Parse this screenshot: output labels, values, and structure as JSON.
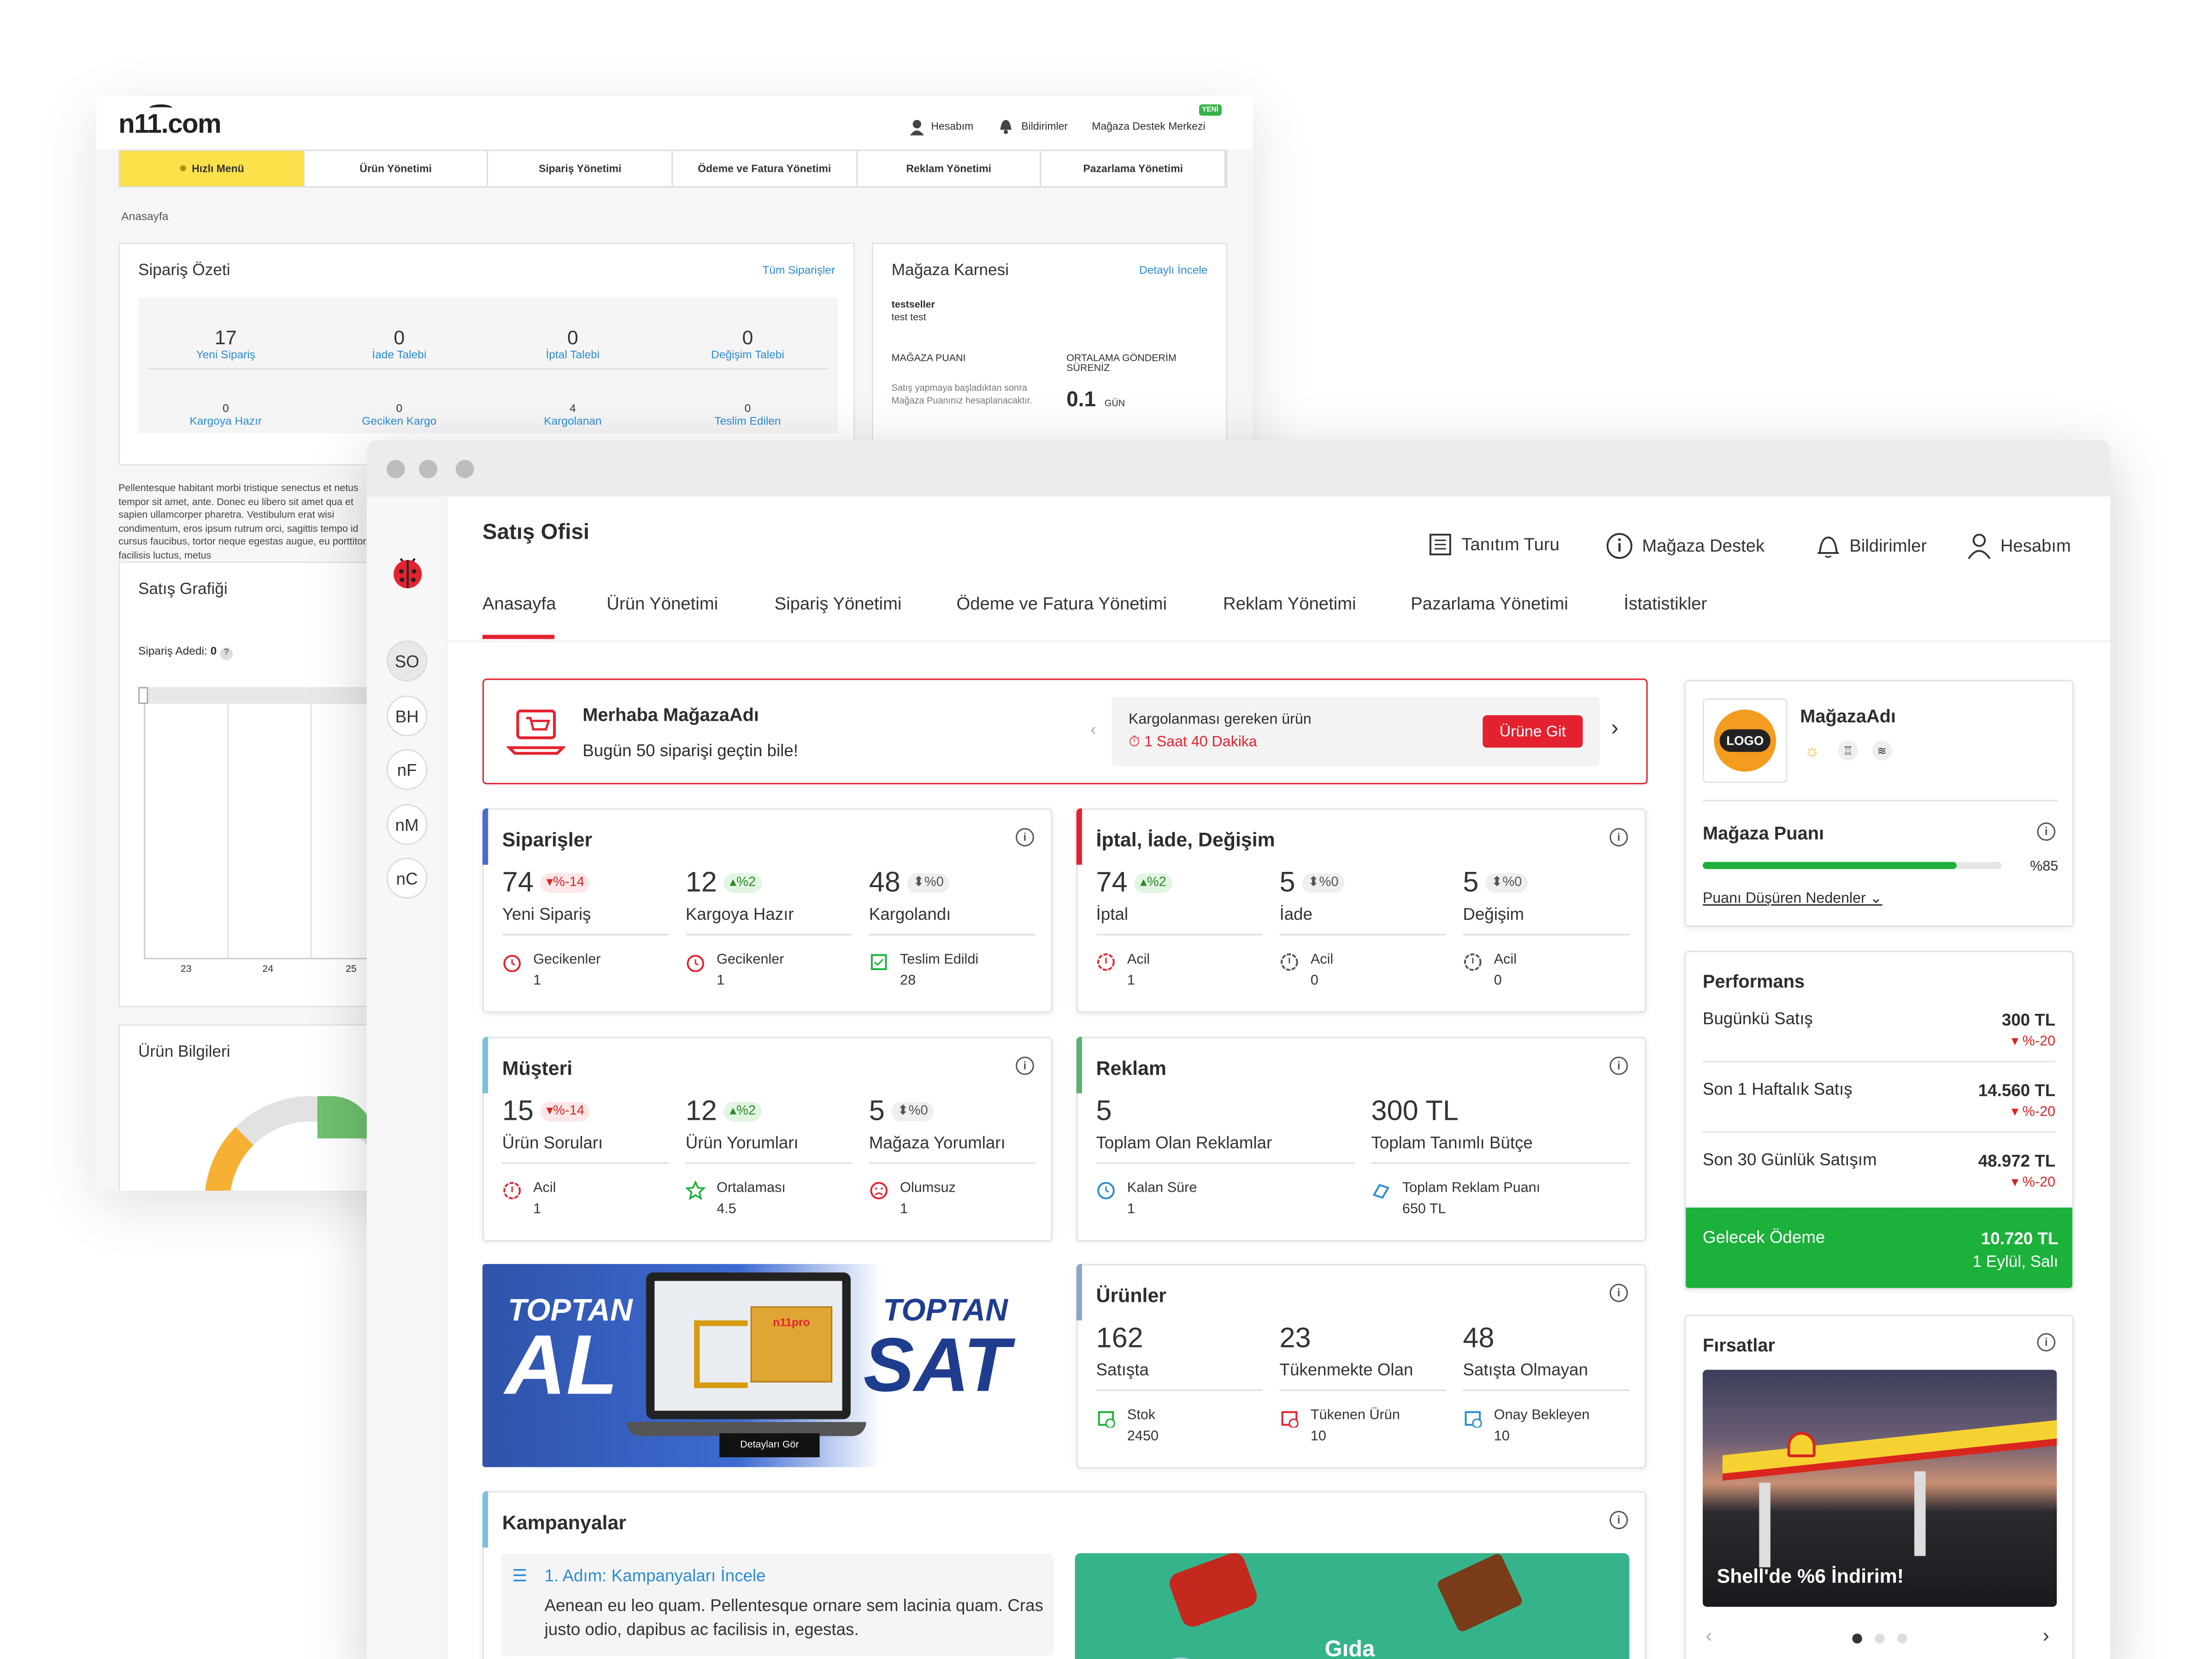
{
  "old": {
    "logo": "n11.com",
    "top_links": [
      "Hesabım",
      "Bildirimler",
      "Mağaza Destek Merkezi"
    ],
    "new_badge": "YENİ",
    "tabs": [
      "Hızlı Menü",
      "Ürün Yönetimi",
      "Sipariş Yönetimi",
      "Ödeme ve Fatura Yönetimi",
      "Reklam Yönetimi",
      "Pazarlama Yönetimi"
    ],
    "breadcrumb": "Anasayfa",
    "order_summary": {
      "title": "Sipariş Özeti",
      "link": "Tüm Siparişler",
      "row1": [
        {
          "v": "17",
          "l": "Yeni Sipariş"
        },
        {
          "v": "0",
          "l": "İade Talebi"
        },
        {
          "v": "0",
          "l": "İptal Talebi"
        },
        {
          "v": "0",
          "l": "Değişim Talebi"
        }
      ],
      "row2": [
        {
          "v": "0",
          "l": "Kargoya Hazır"
        },
        {
          "v": "0",
          "l": "Geciken Kargo"
        },
        {
          "v": "4",
          "l": "Kargolanan"
        },
        {
          "v": "0",
          "l": "Teslim Edilen"
        }
      ]
    },
    "store_card": {
      "title": "Mağaza Karnesi",
      "link": "Detaylı İncele",
      "seller": "testseller",
      "seller_sub": "test test",
      "score_label": "MAĞAZA PUANI",
      "score_note": "Satış yapmaya başladıktan sonra Mağaza Puanınız hesaplanacaktır.",
      "ship_label": "ORTALAMA GÖNDERİM SÜRENİZ",
      "ship_value": "0.1",
      "ship_unit": "GÜN"
    },
    "lorem": "Pellentesque habitant morbi tristique senectus et netus tempor sit amet, ante. Donec eu libero sit amet qua et sapien ullamcorper pharetra. Vestibulum erat wisi condimentum, eros ipsum rutrum orci, sagittis tempo id cursus faucibus, tortor neque egestas augue, eu porttitor, facilisis luctus, metus",
    "sales_chart": {
      "title": "Satış Grafiği",
      "count_label": "Sipariş Adedi:",
      "count": "0",
      "ticks": [
        "23",
        "24",
        "25"
      ]
    },
    "product_info": {
      "title": "Ürün Bilgileri"
    }
  },
  "app": {
    "title": "Satış Ofisi",
    "top_links": [
      "Tanıtım Turu",
      "Mağaza Destek",
      "Bildirimler",
      "Hesabım"
    ],
    "side_items": [
      "SO",
      "BH",
      "nF",
      "nM",
      "nC"
    ],
    "nav": [
      "Anasayfa",
      "Ürün Yönetimi",
      "Sipariş Yönetimi",
      "Ödeme ve Fatura Yönetimi",
      "Reklam Yönetimi",
      "Pazarlama Yönetimi",
      "İstatistikler"
    ],
    "welcome": {
      "title": "Merhaba MağazaAdı",
      "sub": "Bugün 50 siparişi geçtin bile!",
      "ship_title": "Kargolanması gereken ürün",
      "ship_time": "1 Saat 40 Dakika",
      "button": "Ürüne Git"
    },
    "orders": {
      "title": "Siparişler",
      "cols": [
        {
          "num": "74",
          "badge": "▾%-14",
          "lbl": "Yeni Sipariş",
          "sub": "Gecikenler",
          "sv": "1"
        },
        {
          "num": "12",
          "badge": "▴%2",
          "lbl": "Kargoya Hazır",
          "sub": "Gecikenler",
          "sv": "1"
        },
        {
          "num": "48",
          "badge": "⬍%0",
          "lbl": "Kargolandı",
          "sub": "Teslim Edildi",
          "sv": "28"
        }
      ]
    },
    "returns": {
      "title": "İptal, İade, Değişim",
      "cols": [
        {
          "num": "74",
          "badge": "▴%2",
          "lbl": "İptal",
          "sub": "Acil",
          "sv": "1"
        },
        {
          "num": "5",
          "badge": "⬍%0",
          "lbl": "İade",
          "sub": "Acil",
          "sv": "0"
        },
        {
          "num": "5",
          "badge": "⬍%0",
          "lbl": "Değişim",
          "sub": "Acil",
          "sv": "0"
        }
      ]
    },
    "customer": {
      "title": "Müşteri",
      "cols": [
        {
          "num": "15",
          "badge": "▾%-14",
          "lbl": "Ürün Soruları",
          "sub": "Acil",
          "sv": "1"
        },
        {
          "num": "12",
          "badge": "▴%2",
          "lbl": "Ürün Yorumları",
          "sub": "Ortalaması",
          "sv": "4.5"
        },
        {
          "num": "5",
          "badge": "⬍%0",
          "lbl": "Mağaza Yorumları",
          "sub": "Olumsuz",
          "sv": "1"
        }
      ]
    },
    "ads": {
      "title": "Reklam",
      "cols": [
        {
          "num": "5",
          "lbl": "Toplam Olan Reklamlar",
          "sub": "Kalan Süre",
          "sv": "1"
        },
        {
          "num": "300 TL",
          "lbl": "Toplam Tanımlı Bütçe",
          "sub": "Toplam Reklam Puanı",
          "sv": "650 TL"
        }
      ]
    },
    "banner": {
      "left1": "TOPTAN",
      "left2": "AL",
      "right1": "TOPTAN",
      "right2": "SAT",
      "btn": "Detayları Gör",
      "brand": "n11pro"
    },
    "products": {
      "title": "Ürünler",
      "cols": [
        {
          "num": "162",
          "lbl": "Satışta",
          "sub": "Stok",
          "sv": "2450"
        },
        {
          "num": "23",
          "lbl": "Tükenmekte Olan",
          "sub": "Tükenen Ürün",
          "sv": "10"
        },
        {
          "num": "48",
          "lbl": "Satışta Olmayan",
          "sub": "Onay Bekleyen",
          "sv": "10"
        }
      ]
    },
    "campaigns": {
      "title": "Kampanyalar",
      "step": "1. Adım: Kampanyaları İncele",
      "text": "Aenean eu leo quam. Pellentesque ornare sem lacinia quam. Cras justo odio, dapibus ac facilisis in, egestas.",
      "tile": "Gıda"
    },
    "store": {
      "name": "MağazaAdı",
      "logo": "LOGO",
      "score_title": "Mağaza Puanı",
      "score": 0.85,
      "score_text": "%85",
      "reasons": "Puanı Düşüren Nedenler"
    },
    "performance": {
      "title": "Performans",
      "rows": [
        {
          "l": "Bugünkü Satış",
          "v": "300 TL",
          "c": "%-20"
        },
        {
          "l": "Son 1 Haftalık Satış",
          "v": "14.560 TL",
          "c": "%-20"
        },
        {
          "l": "Son 30 Günlük Satışım",
          "v": "48.972 TL",
          "c": "%-20"
        }
      ],
      "future_label": "Gelecek Ödeme",
      "future_value": "10.720 TL",
      "future_date": "1 Eylül, Salı"
    },
    "deals": {
      "title": "Fırsatlar",
      "caption": "Shell'de %6 İndirim!"
    },
    "colors": {
      "accent": "#e4222f",
      "success": "#1bb13a",
      "orders_bar": "#4a6bd1",
      "returns_bar": "#e4222f",
      "customer_bar": "#7cc1d8",
      "ads_bar": "#5db071",
      "products_bar": "#8aa6c8",
      "campaign_bar": "#7cc1d8"
    }
  }
}
